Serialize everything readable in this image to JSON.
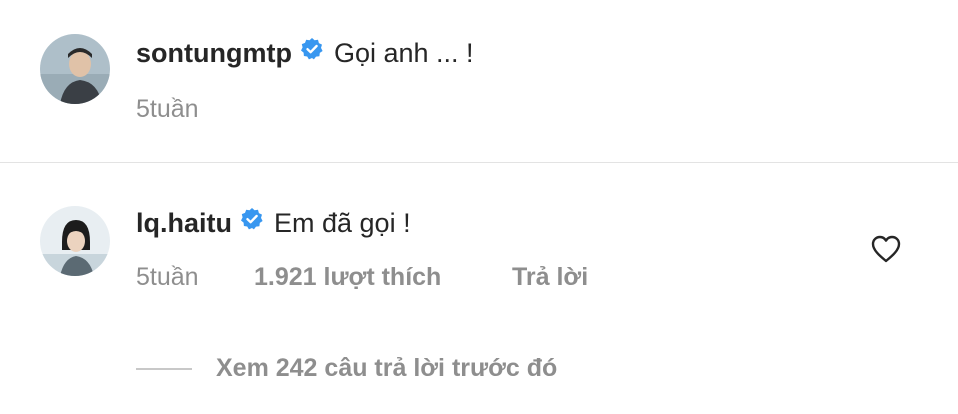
{
  "comment1": {
    "username": "sontungmtp",
    "text": "Gọi anh ... !",
    "time": "5tuần"
  },
  "comment2": {
    "username": "lq.haitu",
    "text": "Em đã gọi !",
    "time": "5tuần",
    "likes": "1.921 lượt thích",
    "reply_label": "Trả lời"
  },
  "view_replies": "Xem 242 câu trả lời trước đó",
  "icons": {
    "verified": "verified-badge-icon",
    "like": "heart-outline-icon"
  },
  "colors": {
    "verified": "#3897f0",
    "text": "#262626",
    "muted": "#8e8e8e"
  }
}
